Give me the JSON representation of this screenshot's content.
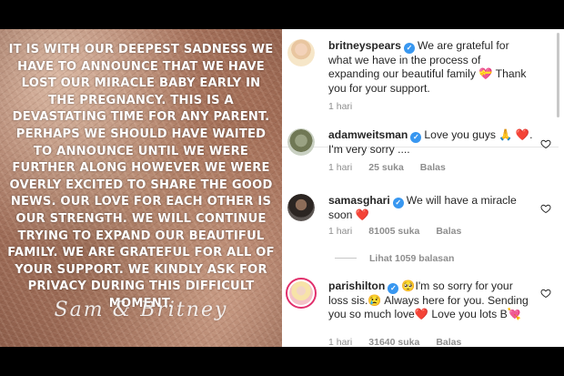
{
  "post": {
    "announcement": "It is with our deepest sadness we have to announce that we have lost our miracle baby early in the pregnancy. This is a devastating time for any parent. Perhaps we should have waited to announce until we were further along however we were overly excited to share the good news. Our love for each other is our strength. We will continue trying to expand our beautiful family. We are grateful for all of your support.  We kindly ask for privacy during this difficult moment.",
    "signature": "Sam  &  Britney"
  },
  "caption": {
    "username": "britneyspears",
    "text": "We are grateful for what we have in the process of expanding our beautiful family 💝 Thank you for your support.",
    "time": "1 hari"
  },
  "comments": [
    {
      "username": "adamweitsman",
      "text": "Love you guys 🙏 ❤️. I'm very sorry ....",
      "time": "1 hari",
      "likes": "25 suka",
      "reply": "Balas"
    },
    {
      "username": "samasghari",
      "text": "We will have a miracle soon ❤️",
      "time": "1 hari",
      "likes": "81005 suka",
      "reply": "Balas",
      "view_replies": "Lihat 1059 balasan"
    },
    {
      "username": "parishilton",
      "text": "🥺I'm so sorry for your loss sis.😢 Always here for you. Sending you so much love❤️ Love you lots B💘",
      "time": "1 hari",
      "likes": "31640 suka",
      "reply": "Balas"
    }
  ],
  "icons": {
    "verified": "verified-badge-icon",
    "like": "heart-outline-icon"
  },
  "colors": {
    "verified": "#3897f0",
    "meta_text": "#8e8e8e",
    "story_ring": "#e1306c"
  }
}
